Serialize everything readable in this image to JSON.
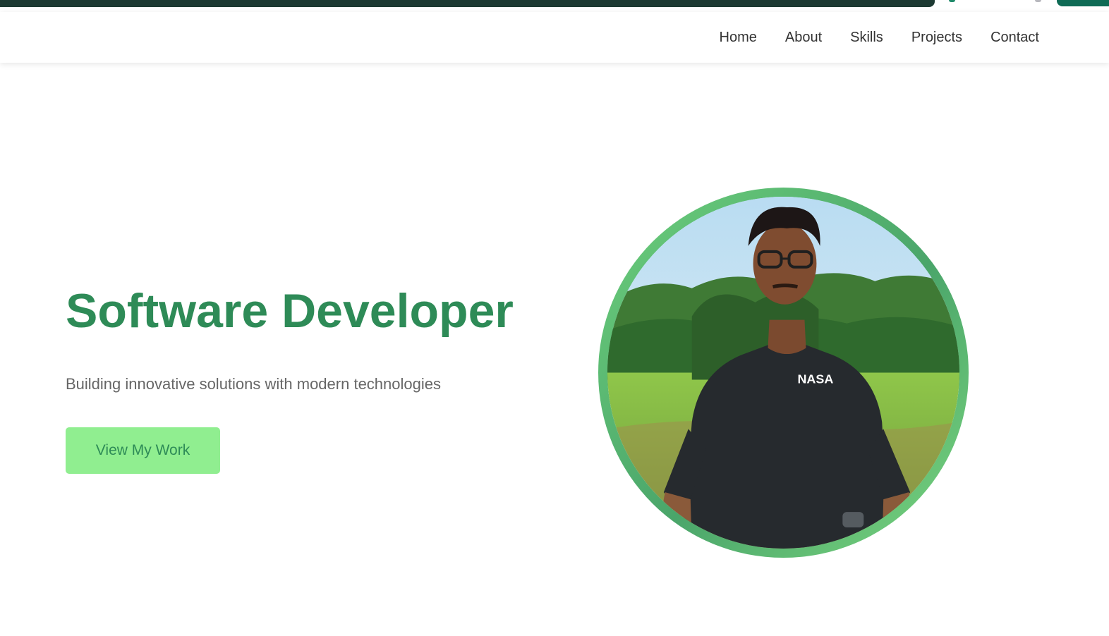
{
  "nav": {
    "items": [
      {
        "label": "Home"
      },
      {
        "label": "About"
      },
      {
        "label": "Skills"
      },
      {
        "label": "Projects"
      },
      {
        "label": "Contact"
      }
    ]
  },
  "hero": {
    "title": "Software Developer",
    "subtitle": "Building innovative solutions with modern technologies",
    "cta_label": "View My Work",
    "portrait_shirt_text": "NASA"
  },
  "colors": {
    "accent": "#2e8b57",
    "button_bg": "#90ee90",
    "ring": "#5cb96f"
  }
}
